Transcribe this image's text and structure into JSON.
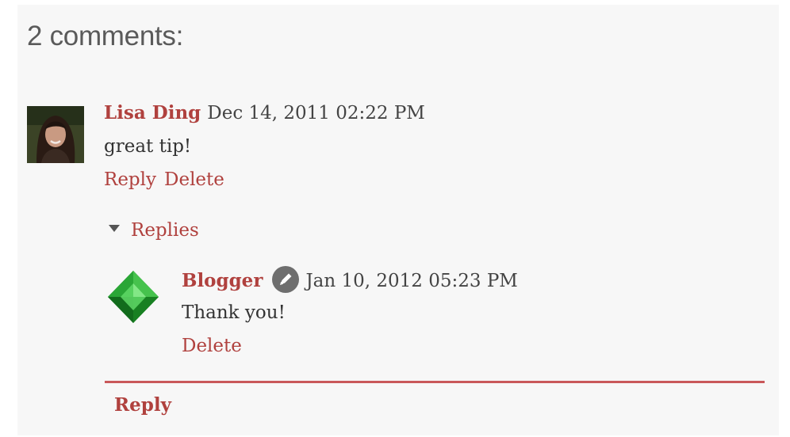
{
  "comments_heading": "2 comments:",
  "comment": {
    "author": "Lisa Ding",
    "date": "Dec 14, 2011 02:22 PM",
    "text": "great tip!",
    "actions": [
      "Reply",
      "Delete"
    ]
  },
  "replies": {
    "toggle_label": "Replies",
    "items": [
      {
        "author": "Blogger",
        "author_icon": "pencil-icon",
        "date": "Jan 10, 2012 05:23 PM",
        "text": "Thank you!",
        "action": "Delete"
      }
    ]
  },
  "reply_link": "Reply",
  "colors": {
    "accent": "#b0413e",
    "divider": "#c9585a",
    "panel": "#f7f7f7"
  }
}
